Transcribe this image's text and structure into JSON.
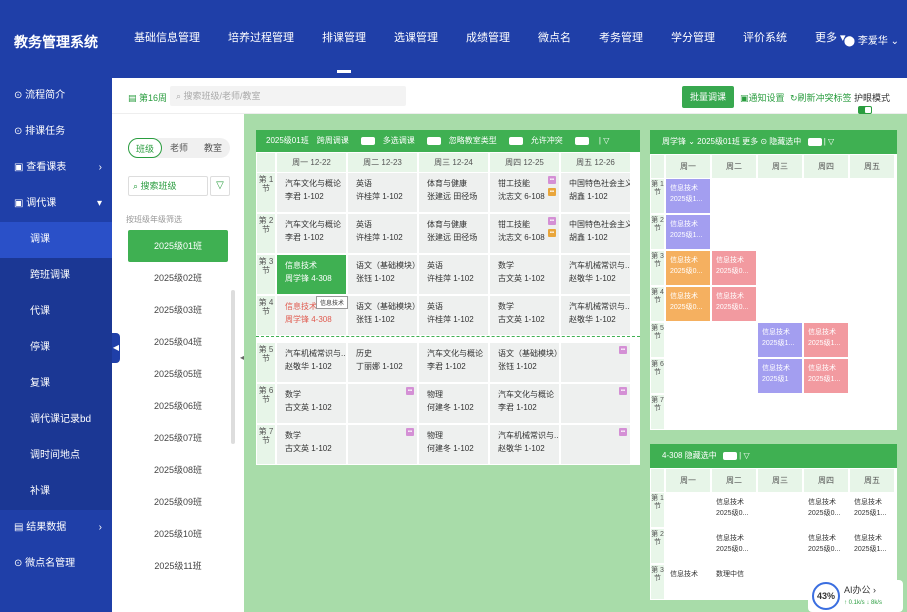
{
  "app": {
    "title": "教务管理系统",
    "user": "李爱华"
  },
  "nav": [
    "基础信息管理",
    "培养过程管理",
    "排课管理",
    "选课管理",
    "成绩管理",
    "微点名",
    "考务管理",
    "学分管理",
    "评价系统",
    "更多 ▾"
  ],
  "sidebar": [
    {
      "label": "流程简介",
      "icon": "⊙"
    },
    {
      "label": "排课任务",
      "icon": "⊙"
    },
    {
      "label": "查看课表",
      "icon": "▣",
      "arrow": "›"
    },
    {
      "label": "调代课",
      "icon": "▣",
      "arrow": "▾"
    },
    {
      "label": "调课",
      "sub": true,
      "active": true
    },
    {
      "label": "跨班调课",
      "sub": true
    },
    {
      "label": "代课",
      "sub": true
    },
    {
      "label": "停课",
      "sub": true
    },
    {
      "label": "复课",
      "sub": true
    },
    {
      "label": "调代课记录bd",
      "sub": true
    },
    {
      "label": "调时间地点",
      "sub": true
    },
    {
      "label": "补课",
      "sub": true
    },
    {
      "label": "结果数据",
      "icon": "▤",
      "arrow": "›"
    },
    {
      "label": "微点名管理",
      "icon": "⊙"
    }
  ],
  "toolbar": {
    "week": "第16周",
    "search_placeholder": "搜索班级/老师/教室",
    "batch": "批量调课",
    "notice": "通知设置",
    "refresh": "刷新冲突标签",
    "eye": "护眼模式"
  },
  "left": {
    "tabs": [
      "班级",
      "老师",
      "教室"
    ],
    "search": "搜索班级",
    "filter": "▽",
    "hint": "按班级年级筛选",
    "classes": [
      "2025级01班",
      "2025级02班",
      "2025级03班",
      "2025级04班",
      "2025级05班",
      "2025级06班",
      "2025级07班",
      "2025级08班",
      "2025级09班",
      "2025级10班",
      "2025级11班"
    ]
  },
  "sched": {
    "header": [
      "2025级01班",
      "跨周调课",
      "多选调课",
      "忽略教室类型",
      "允许冲突"
    ],
    "days": [
      "周一 12-22",
      "周二 12-23",
      "周三 12-24",
      "周四 12-25",
      "周五 12-26"
    ],
    "tooltip": "信息技术",
    "rows": [
      {
        "p": "第 1 节",
        "c": [
          [
            "汽车文化与概论",
            "李君 1-102"
          ],
          [
            "英语",
            "许桂萍 1-102"
          ],
          [
            "体育与健康",
            "张建远 田径场"
          ],
          [
            "钳工技能",
            "沈志文 6-108",
            "badge"
          ],
          [
            "中国特色社会主义",
            "胡鑫 1-102"
          ]
        ]
      },
      {
        "p": "第 2 节",
        "c": [
          [
            "汽车文化与概论",
            "李君 1-102"
          ],
          [
            "英语",
            "许桂萍 1-102"
          ],
          [
            "体育与健康",
            "张建远 田径场"
          ],
          [
            "钳工技能",
            "沈志文 6-108",
            "badge"
          ],
          [
            "中国特色社会主义",
            "胡鑫 1-102"
          ]
        ]
      },
      {
        "p": "第 3 节",
        "c": [
          [
            "信息技术",
            "周学锋 4-308",
            "g"
          ],
          [
            "语文（基础模块）",
            "张钰 1-102"
          ],
          [
            "英语",
            "许桂萍 1-102"
          ],
          [
            "数学",
            "古文英 1-102"
          ],
          [
            "汽车机械常识与...",
            "赵敬华 1-102"
          ]
        ]
      },
      {
        "p": "第 4 节",
        "c": [
          [
            "信息技术",
            "周学锋 4-308",
            "rd"
          ],
          [
            "语文（基础模块）",
            "张钰 1-102"
          ],
          [
            "英语",
            "许桂萍 1-102"
          ],
          [
            "数学",
            "古文英 1-102"
          ],
          [
            "汽车机械常识与...",
            "赵敬华 1-102"
          ]
        ]
      },
      {
        "sep": true
      },
      {
        "p": "第 5 节",
        "c": [
          [
            "汽车机械常识与...",
            "赵敬华 1-102"
          ],
          [
            "历史",
            "丁丽娜 1-102"
          ],
          [
            "汽车文化与概论",
            "李君 1-102"
          ],
          [
            "语文（基础模块）",
            "张钰 1-102"
          ],
          [
            "",
            "",
            "e"
          ]
        ]
      },
      {
        "p": "第 6 节",
        "c": [
          [
            "数学",
            "古文英 1-102"
          ],
          [
            "",
            "",
            "e"
          ],
          [
            "物理",
            "何建冬 1-102"
          ],
          [
            "汽车文化与概论",
            "李君 1-102"
          ],
          [
            "",
            "",
            "e"
          ]
        ]
      },
      {
        "p": "第 7 节",
        "c": [
          [
            "数学",
            "古文英 1-102"
          ],
          [
            "",
            "",
            "e"
          ],
          [
            "物理",
            "何建冬 1-102"
          ],
          [
            "汽车机械常识与...",
            "赵敬华 1-102"
          ],
          [
            "",
            "",
            "e"
          ]
        ]
      }
    ]
  },
  "right1": {
    "header": [
      "周学锋 ⌄",
      "2025级01班",
      "更多 ⊙",
      "隐藏选中"
    ],
    "cols": [
      "周一",
      "周二",
      "周三",
      "周四",
      "周五"
    ]
  },
  "right2": {
    "header": [
      "4-308",
      "隐藏选中"
    ],
    "cols": [
      "周一",
      "周二",
      "周三",
      "周四",
      "周五"
    ]
  },
  "widget": {
    "pct": "43%",
    "ai": "AI办公 ›",
    "speed": "↑ 0.1k/s ↓ 8k/s"
  },
  "colors": {
    "brand": "#1f3fa8",
    "accent": "#3fb052"
  }
}
